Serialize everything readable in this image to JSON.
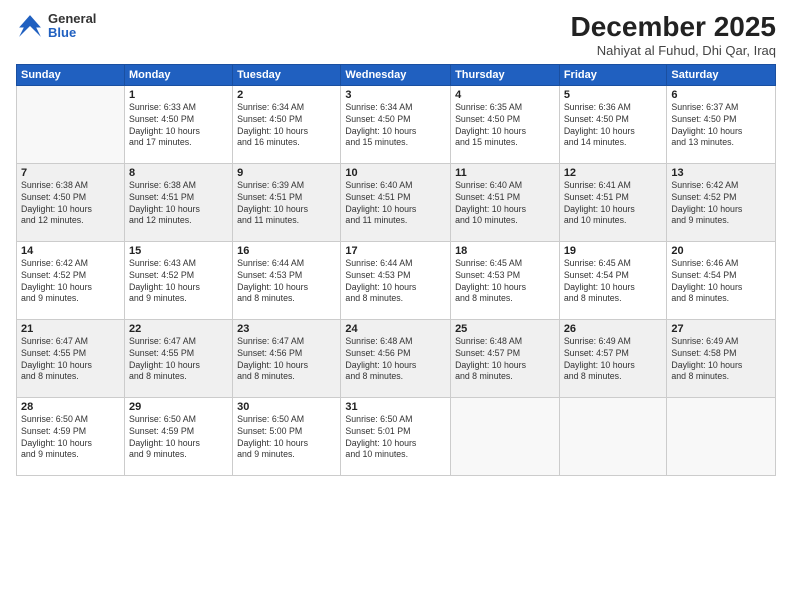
{
  "logo": {
    "general": "General",
    "blue": "Blue"
  },
  "header": {
    "month": "December 2025",
    "location": "Nahiyat al Fuhud, Dhi Qar, Iraq"
  },
  "weekdays": [
    "Sunday",
    "Monday",
    "Tuesday",
    "Wednesday",
    "Thursday",
    "Friday",
    "Saturday"
  ],
  "weeks": [
    [
      {
        "day": "",
        "info": ""
      },
      {
        "day": "1",
        "info": "Sunrise: 6:33 AM\nSunset: 4:50 PM\nDaylight: 10 hours\nand 17 minutes."
      },
      {
        "day": "2",
        "info": "Sunrise: 6:34 AM\nSunset: 4:50 PM\nDaylight: 10 hours\nand 16 minutes."
      },
      {
        "day": "3",
        "info": "Sunrise: 6:34 AM\nSunset: 4:50 PM\nDaylight: 10 hours\nand 15 minutes."
      },
      {
        "day": "4",
        "info": "Sunrise: 6:35 AM\nSunset: 4:50 PM\nDaylight: 10 hours\nand 15 minutes."
      },
      {
        "day": "5",
        "info": "Sunrise: 6:36 AM\nSunset: 4:50 PM\nDaylight: 10 hours\nand 14 minutes."
      },
      {
        "day": "6",
        "info": "Sunrise: 6:37 AM\nSunset: 4:50 PM\nDaylight: 10 hours\nand 13 minutes."
      }
    ],
    [
      {
        "day": "7",
        "info": "Sunrise: 6:38 AM\nSunset: 4:50 PM\nDaylight: 10 hours\nand 12 minutes."
      },
      {
        "day": "8",
        "info": "Sunrise: 6:38 AM\nSunset: 4:51 PM\nDaylight: 10 hours\nand 12 minutes."
      },
      {
        "day": "9",
        "info": "Sunrise: 6:39 AM\nSunset: 4:51 PM\nDaylight: 10 hours\nand 11 minutes."
      },
      {
        "day": "10",
        "info": "Sunrise: 6:40 AM\nSunset: 4:51 PM\nDaylight: 10 hours\nand 11 minutes."
      },
      {
        "day": "11",
        "info": "Sunrise: 6:40 AM\nSunset: 4:51 PM\nDaylight: 10 hours\nand 10 minutes."
      },
      {
        "day": "12",
        "info": "Sunrise: 6:41 AM\nSunset: 4:51 PM\nDaylight: 10 hours\nand 10 minutes."
      },
      {
        "day": "13",
        "info": "Sunrise: 6:42 AM\nSunset: 4:52 PM\nDaylight: 10 hours\nand 9 minutes."
      }
    ],
    [
      {
        "day": "14",
        "info": "Sunrise: 6:42 AM\nSunset: 4:52 PM\nDaylight: 10 hours\nand 9 minutes."
      },
      {
        "day": "15",
        "info": "Sunrise: 6:43 AM\nSunset: 4:52 PM\nDaylight: 10 hours\nand 9 minutes."
      },
      {
        "day": "16",
        "info": "Sunrise: 6:44 AM\nSunset: 4:53 PM\nDaylight: 10 hours\nand 8 minutes."
      },
      {
        "day": "17",
        "info": "Sunrise: 6:44 AM\nSunset: 4:53 PM\nDaylight: 10 hours\nand 8 minutes."
      },
      {
        "day": "18",
        "info": "Sunrise: 6:45 AM\nSunset: 4:53 PM\nDaylight: 10 hours\nand 8 minutes."
      },
      {
        "day": "19",
        "info": "Sunrise: 6:45 AM\nSunset: 4:54 PM\nDaylight: 10 hours\nand 8 minutes."
      },
      {
        "day": "20",
        "info": "Sunrise: 6:46 AM\nSunset: 4:54 PM\nDaylight: 10 hours\nand 8 minutes."
      }
    ],
    [
      {
        "day": "21",
        "info": "Sunrise: 6:47 AM\nSunset: 4:55 PM\nDaylight: 10 hours\nand 8 minutes."
      },
      {
        "day": "22",
        "info": "Sunrise: 6:47 AM\nSunset: 4:55 PM\nDaylight: 10 hours\nand 8 minutes."
      },
      {
        "day": "23",
        "info": "Sunrise: 6:47 AM\nSunset: 4:56 PM\nDaylight: 10 hours\nand 8 minutes."
      },
      {
        "day": "24",
        "info": "Sunrise: 6:48 AM\nSunset: 4:56 PM\nDaylight: 10 hours\nand 8 minutes."
      },
      {
        "day": "25",
        "info": "Sunrise: 6:48 AM\nSunset: 4:57 PM\nDaylight: 10 hours\nand 8 minutes."
      },
      {
        "day": "26",
        "info": "Sunrise: 6:49 AM\nSunset: 4:57 PM\nDaylight: 10 hours\nand 8 minutes."
      },
      {
        "day": "27",
        "info": "Sunrise: 6:49 AM\nSunset: 4:58 PM\nDaylight: 10 hours\nand 8 minutes."
      }
    ],
    [
      {
        "day": "28",
        "info": "Sunrise: 6:50 AM\nSunset: 4:59 PM\nDaylight: 10 hours\nand 9 minutes."
      },
      {
        "day": "29",
        "info": "Sunrise: 6:50 AM\nSunset: 4:59 PM\nDaylight: 10 hours\nand 9 minutes."
      },
      {
        "day": "30",
        "info": "Sunrise: 6:50 AM\nSunset: 5:00 PM\nDaylight: 10 hours\nand 9 minutes."
      },
      {
        "day": "31",
        "info": "Sunrise: 6:50 AM\nSunset: 5:01 PM\nDaylight: 10 hours\nand 10 minutes."
      },
      {
        "day": "",
        "info": ""
      },
      {
        "day": "",
        "info": ""
      },
      {
        "day": "",
        "info": ""
      }
    ]
  ]
}
